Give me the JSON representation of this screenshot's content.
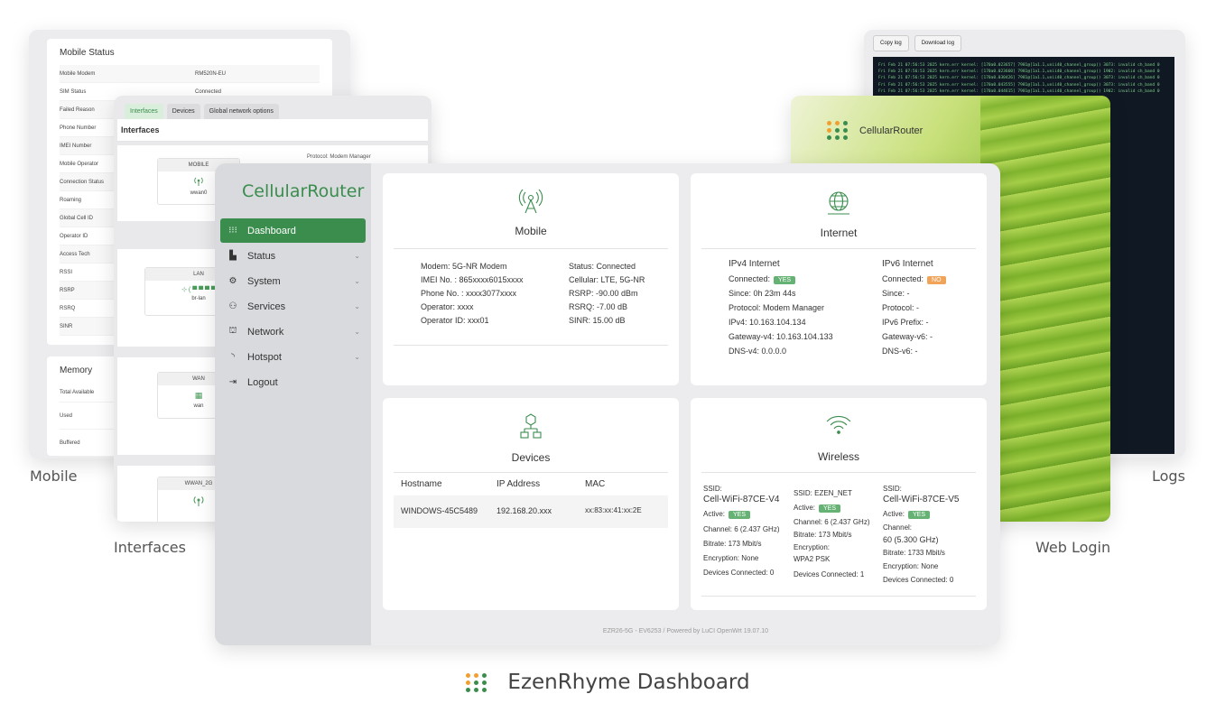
{
  "mobile_status": {
    "title": "Mobile Status",
    "rows": [
      {
        "k": "Mobile Modem",
        "v": "RM520N-EU"
      },
      {
        "k": "SIM Status",
        "v": "Connected"
      },
      {
        "k": "Failed Reason",
        "v": ""
      },
      {
        "k": "Phone Number",
        "v": ""
      },
      {
        "k": "IMEI Number",
        "v": ""
      },
      {
        "k": "Mobile Operator",
        "v": ""
      },
      {
        "k": "Connection Status",
        "v": ""
      },
      {
        "k": "Roaming",
        "v": ""
      },
      {
        "k": "Global Cell ID",
        "v": ""
      },
      {
        "k": "Operator ID",
        "v": ""
      },
      {
        "k": "Access Tech",
        "v": ""
      },
      {
        "k": "RSSI",
        "v": ""
      },
      {
        "k": "RSRP",
        "v": ""
      },
      {
        "k": "RSRQ",
        "v": ""
      },
      {
        "k": "SINR",
        "v": ""
      }
    ],
    "memory_title": "Memory",
    "memory_rows": [
      "Total Available",
      "Used",
      "Buffered"
    ]
  },
  "interfaces": {
    "tabs": [
      "Interfaces",
      "Devices",
      "Global network options"
    ],
    "title": "Interfaces",
    "protocol": "Protocol: Modem Manager",
    "boxes": [
      {
        "name": "MOBILE",
        "sub": "wwan0"
      },
      {
        "name": "LAN",
        "sub": "br-lan"
      },
      {
        "name": "WAN",
        "sub": "wan"
      },
      {
        "name": "WWAN_2G",
        "sub": ""
      }
    ]
  },
  "logs": {
    "copy_label": "Copy log",
    "download_label": "Download log",
    "lines": [
      "Fri Feb 21 07:56:53 2025 kern.err kernel: [170a0.023657] 7981@[1a1.1,unii40_channel_group() 3073: invalid ch_band 0",
      "Fri Feb 21 07:56:53 2025 kern.err kernel: [170a0.023660] 7981@[1a1.1,unii40_channel_group() 1902: invalid ch_band 0",
      "Fri Feb 21 07:56:53 2025 kern.err kernel: [170a0.030426] 7981@[1a1.1,unii40_channel_group() 3073: invalid ch_band 0",
      "Fri Feb 21 07:56:53 2025 kern.err kernel: [170a0.043555] 7981@[1a1.1,unii40_channel_group() 3073: invalid ch_band 0",
      "Fri Feb 21 07:56:53 2025 kern.err kernel: [170a0.044615] 7981@[1a1.1,unii40_channel_group() 1902: invalid ch_band 0"
    ]
  },
  "web_login": {
    "brand": "CellularRouter"
  },
  "dashboard": {
    "brand": "CellularRouter",
    "nav": [
      {
        "label": "Dashboard",
        "icon": "grid-icon",
        "glyph": "⁝⁝⁝",
        "has_chevron": false
      },
      {
        "label": "Status",
        "icon": "status-icon",
        "glyph": "▙",
        "has_chevron": true
      },
      {
        "label": "System",
        "icon": "gear-icon",
        "glyph": "⚙",
        "has_chevron": true
      },
      {
        "label": "Services",
        "icon": "services-icon",
        "glyph": "⚇",
        "has_chevron": true
      },
      {
        "label": "Network",
        "icon": "network-icon",
        "glyph": "⛫",
        "has_chevron": true
      },
      {
        "label": "Hotspot",
        "icon": "hotspot-icon",
        "glyph": "◝",
        "has_chevron": true
      },
      {
        "label": "Logout",
        "icon": "logout-icon",
        "glyph": "⇥",
        "has_chevron": false
      }
    ],
    "mobile": {
      "title": "Mobile",
      "left": [
        "Modem: 5G-NR Modem",
        "IMEI No. : 865xxxx6015xxxx",
        "Phone No. : xxxx3077xxxx",
        "Operator: xxxx",
        "Operator ID: xxx01"
      ],
      "right": [
        "Status: Connected",
        "Cellular: LTE, 5G-NR",
        "RSRP: -90.00 dBm",
        "RSRQ: -7.00 dB",
        "SINR: 15.00 dB"
      ]
    },
    "internet": {
      "title": "Internet",
      "ipv4": {
        "head": "IPv4 Internet",
        "connected_label": "Connected:",
        "connected_badge": "YES",
        "lines": [
          "Since: 0h 23m 44s",
          "Protocol: Modem Manager",
          "IPv4: 10.163.104.134",
          "Gateway-v4: 10.163.104.133",
          "DNS-v4: 0.0.0.0"
        ]
      },
      "ipv6": {
        "head": "IPv6 Internet",
        "connected_label": "Connected:",
        "connected_badge": "NO",
        "lines": [
          "Since: -",
          "Protocol: -",
          "IPv6 Prefix: -",
          "Gateway-v6: -",
          "DNS-v6: -"
        ]
      }
    },
    "devices": {
      "title": "Devices",
      "headers": [
        "Hostname",
        "IP Address",
        "MAC"
      ],
      "rows": [
        [
          "WINDOWS-45C5489",
          "192.168.20.xxx",
          "xx:83:xx:41:xx:2E"
        ]
      ]
    },
    "wireless": {
      "title": "Wireless",
      "col1": {
        "ssid_label": "SSID:",
        "ssid": "Cell-WiFi-87CE-V4",
        "active_label": "Active:",
        "active_badge": "YES",
        "channel": "Channel: 6 (2.437 GHz)",
        "bitrate": "Bitrate: 173 Mbit/s",
        "encryption": "Encryption: None",
        "devices": "Devices Connected: 0"
      },
      "col2": {
        "ssid": "SSID: EZEN_NET",
        "active_label": "Active:",
        "active_badge": "YES",
        "channel": "Channel: 6 (2.437 GHz)",
        "bitrate": "Bitrate: 173 Mbit/s",
        "encryption_label": "Encryption:",
        "encryption": "WPA2 PSK",
        "devices": "Devices Connected: 1"
      },
      "col3": {
        "ssid_label": "SSID:",
        "ssid": "Cell-WiFi-87CE-V5",
        "active_label": "Active:",
        "active_badge": "YES",
        "channel_label": "Channel:",
        "channel": "60 (5.300 GHz)",
        "bitrate": "Bitrate: 1733 Mbit/s",
        "encryption": "Encryption: None",
        "devices": "Devices Connected: 0"
      }
    },
    "footer": "EZR26-5G - EV6253 / Powered by LuCI OpenWrt 19.07.10"
  },
  "captions": {
    "mobile": "Mobile",
    "interfaces": "Interfaces",
    "logs": "Logs",
    "web_login": "Web Login"
  },
  "product_title": "EzenRhyme Dashboard",
  "colors": {
    "accent": "#3b8d4e",
    "badge_yes": "#65b274",
    "badge_no": "#f0a45a",
    "logo_orange": "#f0a030"
  }
}
